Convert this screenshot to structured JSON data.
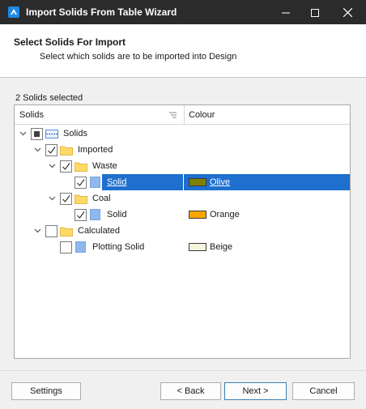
{
  "window": {
    "title": "Import Solids From Table Wizard",
    "minimize_icon": "minimize-icon",
    "maximize_icon": "maximize-icon",
    "close_icon": "close-icon"
  },
  "header": {
    "title": "Select Solids For Import",
    "subtitle": "Select which solids are to be imported into Design"
  },
  "selection_count": "2 Solids selected",
  "grid": {
    "columns": [
      "Solids",
      "Colour"
    ],
    "rows": [
      {
        "label": "Solids",
        "level": 0,
        "checkbox": "indeterminate",
        "icon": "solids-root-icon",
        "expanded": true
      },
      {
        "label": "Imported",
        "level": 1,
        "checkbox": "checked",
        "icon": "folder-icon",
        "expanded": true
      },
      {
        "label": "Waste",
        "level": 2,
        "checkbox": "checked",
        "icon": "folder-icon",
        "expanded": true
      },
      {
        "label": "Solid",
        "level": 3,
        "checkbox": "checked",
        "icon": "solid-icon",
        "selected": true,
        "colour": "Olive",
        "swatch": "#808000"
      },
      {
        "label": "Coal",
        "level": 2,
        "checkbox": "checked",
        "icon": "folder-icon",
        "expanded": true
      },
      {
        "label": "Solid",
        "level": 3,
        "checkbox": "checked",
        "icon": "solid-icon",
        "colour": "Orange",
        "swatch": "#ffa500"
      },
      {
        "label": "Calculated",
        "level": 1,
        "checkbox": "unchecked",
        "icon": "folder-icon",
        "expanded": true
      },
      {
        "label": "Plotting Solid",
        "level": 2,
        "checkbox": "unchecked",
        "icon": "solid-icon",
        "colour": "Beige",
        "swatch": "#f5f5dc"
      }
    ]
  },
  "buttons": {
    "settings": "Settings",
    "back": "< Back",
    "next": "Next >",
    "cancel": "Cancel"
  },
  "colors": {
    "titlebar": "#2b2b2b",
    "selection": "#1e6fce",
    "folder": "#ffd966",
    "solid_icon": "#8fb8ee"
  }
}
